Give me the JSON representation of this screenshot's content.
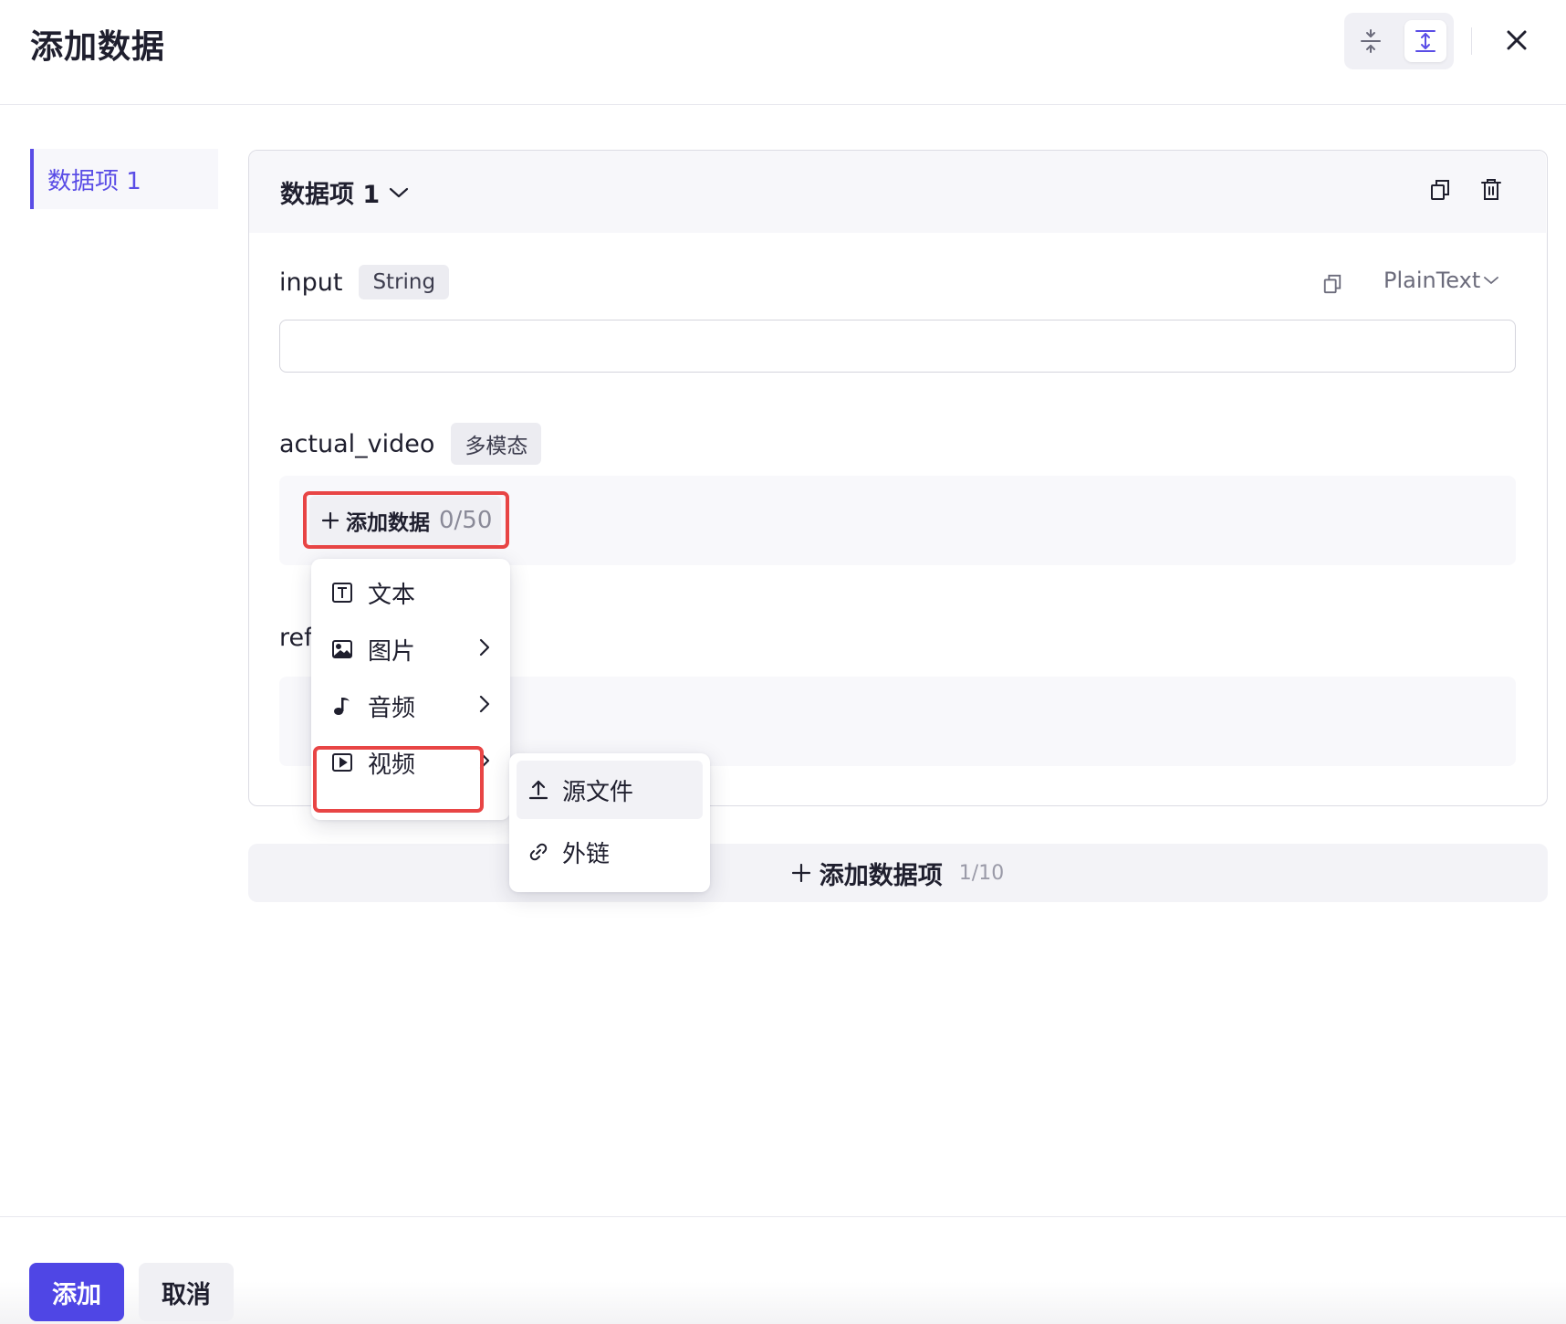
{
  "dialog": {
    "title": "添加数据"
  },
  "sidebar": {
    "items": [
      {
        "label": "数据项 1",
        "active": true
      }
    ]
  },
  "card": {
    "title": "数据项 1",
    "fields": [
      {
        "name": "input",
        "type_tag": "String",
        "format": "PlainText",
        "value": ""
      },
      {
        "name": "actual_video",
        "type_tag": "多模态",
        "add_label": "添加数据",
        "add_count": "0/50"
      },
      {
        "name_visible": "ref"
      }
    ]
  },
  "type_menu": {
    "items": [
      {
        "label": "文本",
        "icon": "text-icon",
        "has_submenu": false
      },
      {
        "label": "图片",
        "icon": "image-icon",
        "has_submenu": true
      },
      {
        "label": "音频",
        "icon": "music-note-icon",
        "has_submenu": true
      },
      {
        "label": "视频",
        "icon": "video-icon",
        "has_submenu": true
      }
    ]
  },
  "sub_menu": {
    "items": [
      {
        "label": "源文件",
        "icon": "upload-icon"
      },
      {
        "label": "外链",
        "icon": "link-icon"
      }
    ]
  },
  "add_item": {
    "label": "添加数据项",
    "count": "1/10"
  },
  "footer": {
    "submit_label": "添加",
    "cancel_label": "取消"
  },
  "colors": {
    "accent": "#4f46e5",
    "highlight": "#e84545"
  }
}
